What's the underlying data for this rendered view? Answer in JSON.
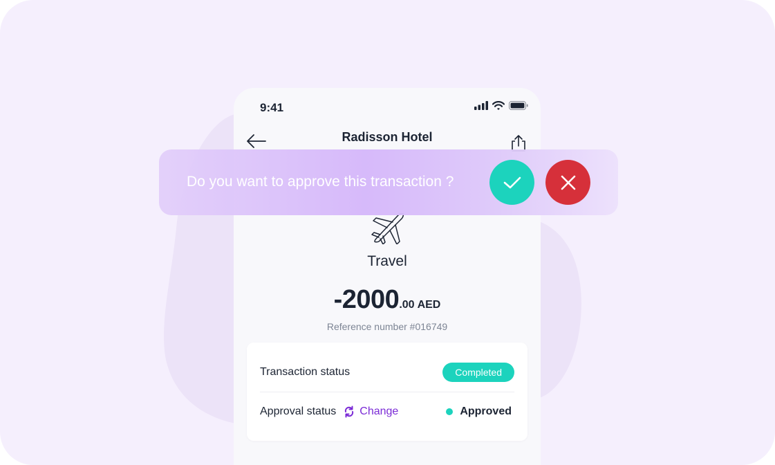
{
  "status_bar": {
    "time": "9:41",
    "icons": [
      "signal-icon",
      "wifi-icon",
      "battery-icon"
    ]
  },
  "nav": {
    "title": "Radisson Hotel",
    "back_icon": "arrow-left-icon",
    "share_icon": "share-icon"
  },
  "transaction": {
    "category_icon": "airplane-icon",
    "category": "Travel",
    "amount_main": "-2000",
    "amount_decimal": ".00",
    "currency": "AED",
    "reference": "Reference number #016749"
  },
  "details": {
    "transaction_status_label": "Transaction status",
    "transaction_status_value": "Completed",
    "approval_status_label": "Approval status",
    "change_label": "Change",
    "approval_value": "Approved"
  },
  "prompt": {
    "question": "Do you want to approve this transaction ?",
    "approve_icon": "check-icon",
    "reject_icon": "close-icon"
  },
  "colors": {
    "accent_teal": "#1cd3bd",
    "reject_red": "#d6303a",
    "link_purple": "#7b2bd6",
    "background": "#f5effd"
  }
}
